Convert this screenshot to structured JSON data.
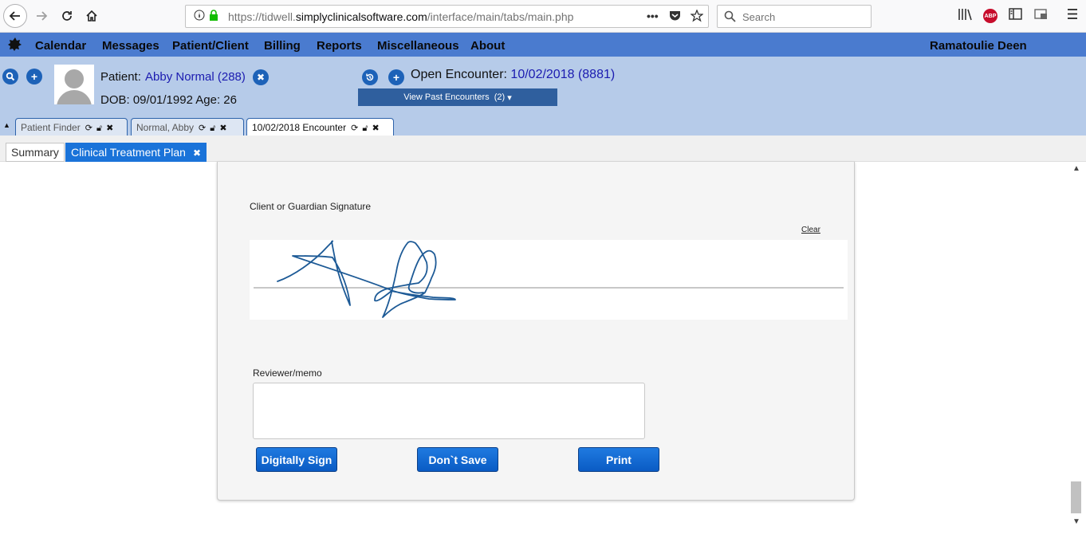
{
  "browser": {
    "url_prefix": "https://tidwell.",
    "url_host": "simplyclinicalsoftware.com",
    "url_path": "/interface/main/tabs/main.php",
    "search_placeholder": "Search",
    "abp_label": "ABP"
  },
  "menu": {
    "items": [
      "Calendar",
      "Messages",
      "Patient/Client",
      "Billing",
      "Reports",
      "Miscellaneous",
      "About"
    ],
    "user": "Ramatoulie Deen"
  },
  "patient": {
    "label": "Patient:",
    "name": "Abby Normal (288)",
    "dob": "DOB: 09/01/1992 Age: 26"
  },
  "encounter": {
    "label": "Open Encounter:",
    "value": "10/02/2018 (8881)",
    "past_button": "View Past Encounters",
    "past_count": "(2)"
  },
  "top_tabs": [
    {
      "label": "Patient Finder",
      "active": false
    },
    {
      "label": "Normal, Abby",
      "active": false
    },
    {
      "label": "10/02/2018 Encounter",
      "active": true
    }
  ],
  "sub_tabs": {
    "summary": "Summary",
    "active": "Clinical Treatment Plan"
  },
  "form": {
    "signature_label": "Client or Guardian Signature",
    "clear_link": "Clear",
    "reviewer_label": "Reviewer/memo",
    "memo_value": "",
    "buttons": {
      "sign": "Digitally Sign",
      "dont_save": "Don`t Save",
      "print": "Print"
    }
  },
  "colors": {
    "menu_bar": "#4a7bcf",
    "patient_header": "#b6cbe9",
    "action_button": "#1a73d9",
    "signature_ink": "#1d5a96"
  }
}
